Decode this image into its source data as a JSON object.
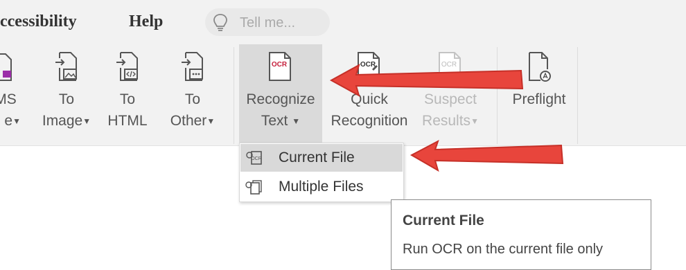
{
  "tabs": [
    {
      "label": "ccessibility"
    },
    {
      "label": "Help"
    }
  ],
  "tell_me": {
    "placeholder": "Tell me...",
    "icon": "lightbulb-icon"
  },
  "ribbon": {
    "partial_button": {
      "line1": "MS",
      "line2": "e"
    },
    "to_image": {
      "line1": "To",
      "line2": "Image"
    },
    "to_html": {
      "line1": "To",
      "line2": "HTML"
    },
    "to_other": {
      "line1": "To",
      "line2": "Other"
    },
    "recognize_text": {
      "line1": "Recognize",
      "line2": "Text",
      "icon_text": "OCR"
    },
    "quick_recognition": {
      "line1": "Quick",
      "line2": "Recognition",
      "icon_text": "OCR"
    },
    "suspect_results": {
      "line1": "Suspect",
      "line2": "Results",
      "icon_text": "OCR"
    },
    "preflight": {
      "line1": "Preflight"
    }
  },
  "dropdown": {
    "items": [
      {
        "label": "Current File"
      },
      {
        "label": "Multiple Files"
      }
    ]
  },
  "tooltip": {
    "title": "Current File",
    "body": "Run OCR on the current file only"
  },
  "colors": {
    "accent_arrow": "#e8453c",
    "ocr_icon": "#c41e3a",
    "highlight": "#dadada",
    "ribbon_bg": "#f2f2f2"
  }
}
